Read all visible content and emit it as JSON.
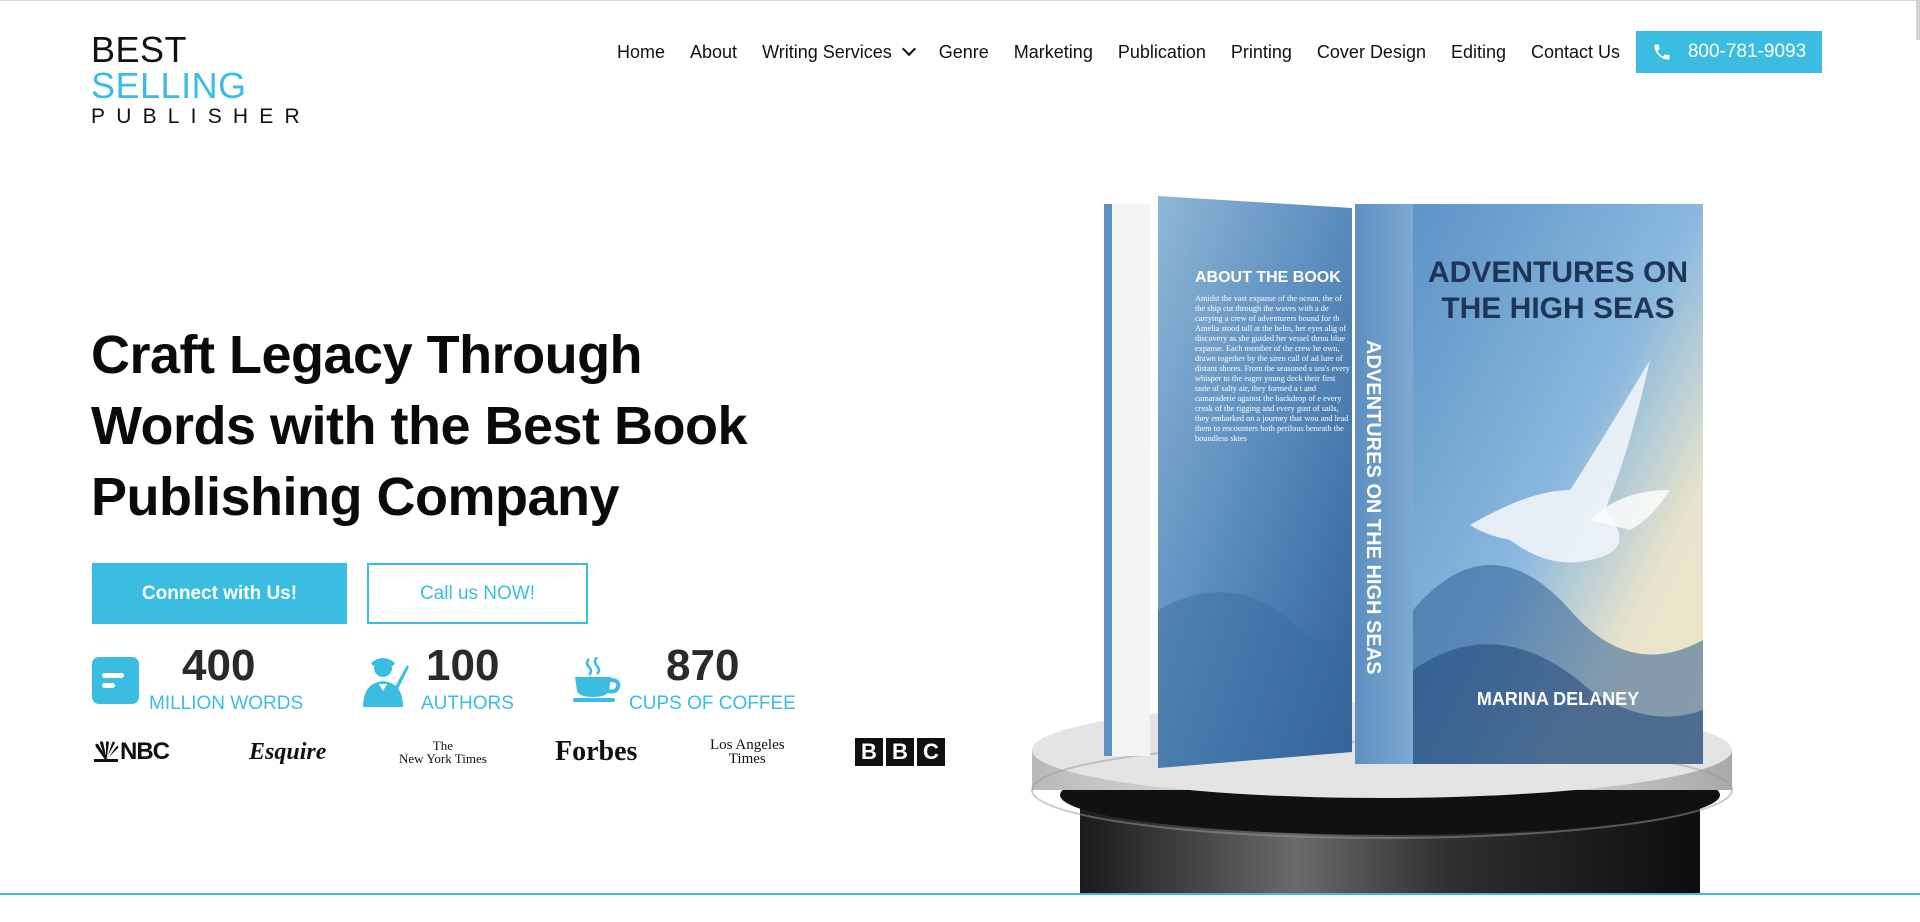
{
  "header": {
    "logo": {
      "line1_dark": "BEST",
      "line1_blue": "SELLING",
      "line2": "PUBLISHER"
    },
    "nav": [
      {
        "label": "Home"
      },
      {
        "label": "About"
      },
      {
        "label": "Writing Services",
        "has_dropdown": true
      },
      {
        "label": "Genre"
      },
      {
        "label": "Marketing"
      },
      {
        "label": "Publication"
      },
      {
        "label": "Printing"
      },
      {
        "label": "Cover Design"
      },
      {
        "label": "Editing"
      },
      {
        "label": "Contact Us"
      }
    ],
    "phone": {
      "number": "800-781-9093",
      "icon": "phone-icon"
    }
  },
  "hero": {
    "title": "Craft Legacy Through Words with the Best Book Publishing Company",
    "primary_button": "Connect with Us!",
    "secondary_button": "Call us NOW!",
    "stats": [
      {
        "value": "400",
        "label": "MILLION WORDS",
        "icon": "document-icon"
      },
      {
        "value": "100",
        "label": "AUTHORS",
        "icon": "author-icon"
      },
      {
        "value": "870",
        "label": "CUPS OF COFFEE",
        "icon": "coffee-cup-icon"
      }
    ],
    "press_logos": [
      {
        "name": "NBC",
        "text": "NBC"
      },
      {
        "name": "Esquire",
        "text": "Esquire"
      },
      {
        "name": "The New York Times",
        "line1": "The",
        "line2": "New York Times"
      },
      {
        "name": "Forbes",
        "text": "Forbes"
      },
      {
        "name": "Los Angeles Times",
        "line1": "Los Angeles",
        "line2": "Times"
      },
      {
        "name": "BBC",
        "letters": [
          "B",
          "B",
          "C"
        ]
      }
    ]
  },
  "book": {
    "back_heading": "ABOUT THE BOOK",
    "back_text": "Amidst the vast expanse of the ocean, the of the ship cut through the waves with a de carrying a crew of adventurers bound for th Amelia stood tall at the helm, her eyes alig of discovery as she guided her vessel throu blue expanse. Each member of the crew he own, drawn together by the siren call of ad lure of distant shores. From the seasoned s sea's every whisper to the eager young deck their first taste of salty air, they formed a t and camaraderie against the backdrop of e every creak of the rigging and every gust of sails, they embarked on a journey that wou and lead them to encounters both perilous beneath the boundless skies",
    "front_title_line1": "ADVENTURES ON",
    "front_title_line2": "THE HIGH SEAS",
    "spine_title": "ADVENTURES ON THE HIGH SEAS",
    "author": "MARINA DELANEY"
  },
  "colors": {
    "accent": "#3bbde1",
    "text": "#111111",
    "stat_number": "#2a2a2a"
  }
}
